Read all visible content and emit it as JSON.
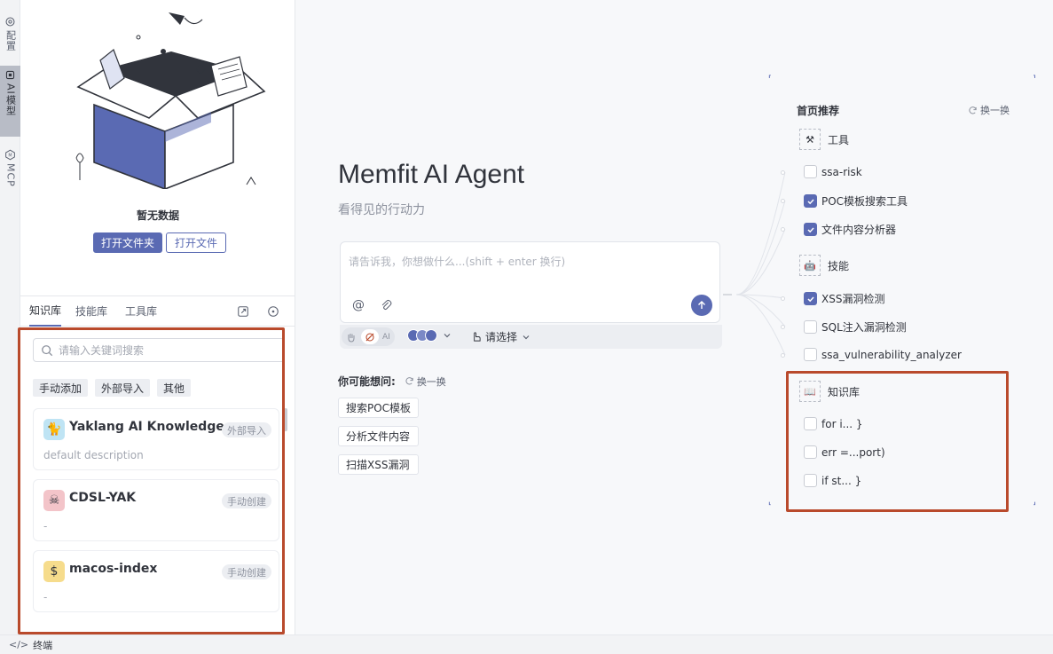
{
  "rail": {
    "items": [
      {
        "label": "配置",
        "icon": "gear-icon"
      },
      {
        "label": "AI模型",
        "icon": "chip-icon"
      },
      {
        "label": "MCP",
        "icon": "mcp-icon"
      }
    ]
  },
  "left": {
    "empty_text": "暂无数据",
    "open_folder": "打开文件夹",
    "open_file": "打开文件",
    "tabs": [
      "知识库",
      "技能库",
      "工具库"
    ],
    "search_placeholder": "请输入关键词搜索",
    "filters": [
      "手动添加",
      "外部导入",
      "其他"
    ],
    "cards": [
      {
        "title": "Yaklang AI Knowledge...",
        "badge": "外部导入",
        "desc": "default description"
      },
      {
        "title": "CDSL-YAK",
        "badge": "手动创建",
        "desc": "-"
      },
      {
        "title": "macos-index",
        "badge": "手动创建",
        "desc": "-"
      }
    ]
  },
  "main": {
    "title": "Memfit AI Agent",
    "subtitle": "看得见的行动力",
    "input_placeholder": "请告诉我，你想做什么...(shift + enter 换行)",
    "mode_chip": "AI",
    "select_label": "请选择",
    "suggest_label": "你可能想问:",
    "refresh": "换一换",
    "suggestions": [
      "搜索POC模板",
      "分析文件内容",
      "扫描XSS漏洞"
    ]
  },
  "recommend": {
    "title": "首页推荐",
    "refresh": "换一换",
    "tools_title": "工具",
    "tools": [
      {
        "label": "ssa-risk",
        "checked": false
      },
      {
        "label": "POC模板搜索工具",
        "checked": true
      },
      {
        "label": "文件内容分析器",
        "checked": true
      }
    ],
    "skills_title": "技能",
    "skills": [
      {
        "label": "XSS漏洞检测",
        "checked": true
      },
      {
        "label": "SQL注入漏洞检测",
        "checked": false
      },
      {
        "label": "ssa_vulnerability_analyzer",
        "checked": false
      }
    ],
    "kb_title": "知识库",
    "kb": [
      {
        "label": "for i... }",
        "checked": false
      },
      {
        "label": "err =...port)",
        "checked": false
      },
      {
        "label": "if st... }",
        "checked": false
      }
    ]
  },
  "bottom": {
    "terminal": "终端"
  },
  "colors": {
    "accent": "#5a6ab3",
    "highlight": "#b94a2c"
  }
}
